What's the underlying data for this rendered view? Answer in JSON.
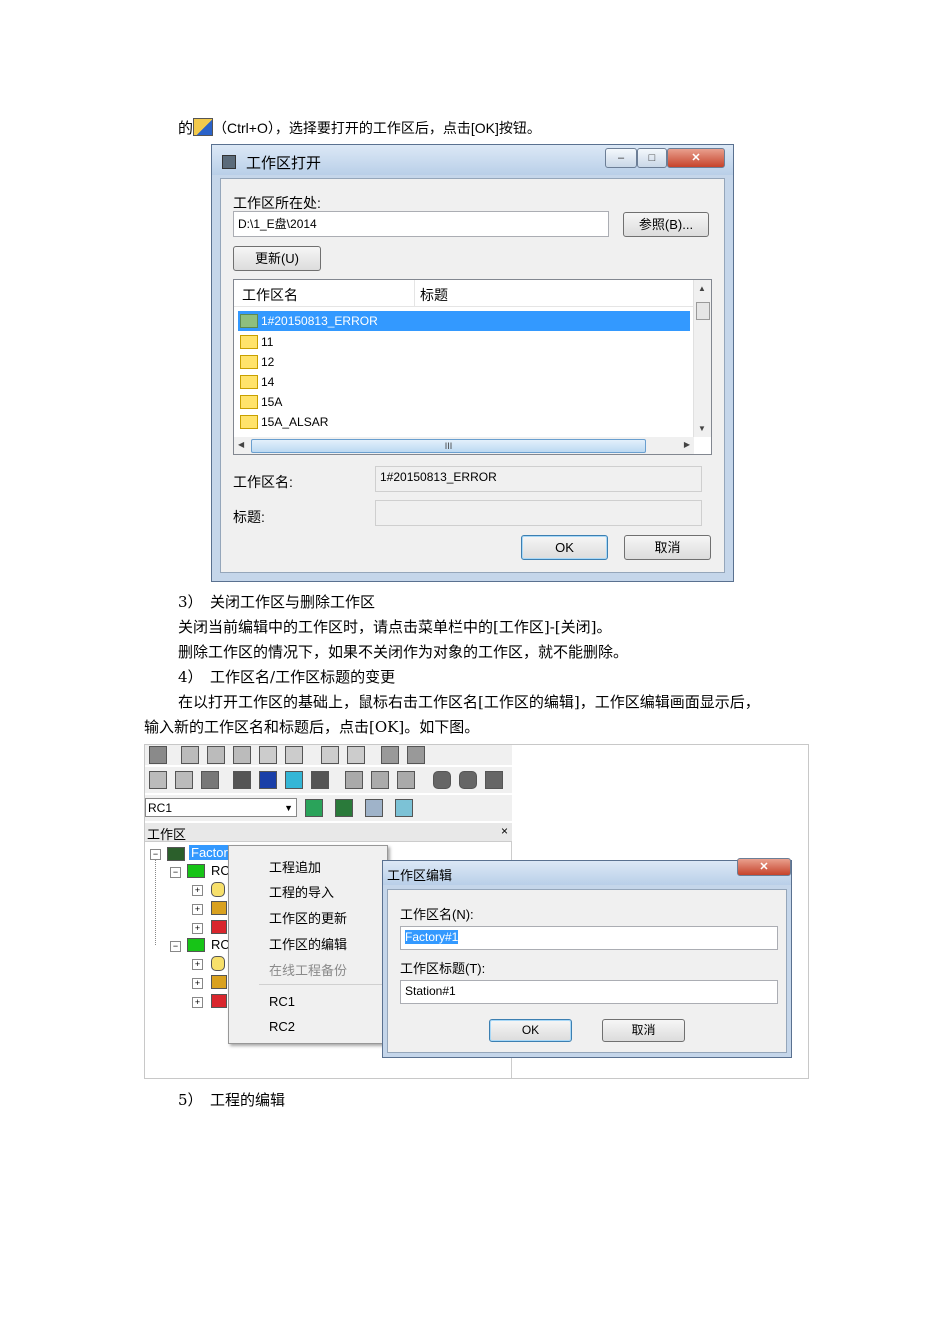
{
  "intro_line": {
    "prefix": "的",
    "suffix": "（Ctrl+O），选择要打开的工作区后，点击[OK]按钮。"
  },
  "dialog_open": {
    "title": "工作区打开",
    "location_label": "工作区所在处:",
    "location_value": "D:\\1_E盘\\2014",
    "browse_button": "参照(B)...",
    "update_button": "更新(U)",
    "columns": [
      "工作区名",
      "标题"
    ],
    "rows": [
      "1#20150813_ERROR",
      "11",
      "12",
      "14",
      "15A",
      "15A_ALSAR"
    ],
    "selected_row": 0,
    "hscroll_thumb": "III",
    "name_label": "工作区名:",
    "name_value": "1#20150813_ERROR",
    "title_label": "标题:",
    "title_value": "",
    "ok_button": "OK",
    "cancel_button": "取消"
  },
  "paragraphs": [
    "3）　关闭工作区与删除工作区",
    "关闭当前编辑中的工作区时，请点击菜单栏中的[工作区]-[关闭]。",
    "删除工作区的情况下，如果不关闭作为对象的工作区，就不能删除。",
    "4）　工作区名/工作区标题的变更",
    "在以打开工作区的基础上，鼠标右击工作区名[工作区的编辑]，工作区编辑画面显示后，",
    "输入新的工作区名和标题后，点击[OK]。如下图。",
    "5）　工程的编辑"
  ],
  "shot2": {
    "combo_value": "RC1",
    "panel_title": "工作区",
    "panel_close": "×",
    "tree_root": "Factory",
    "tree_nodes": [
      "RC",
      "RC"
    ],
    "context_menu": [
      "工程追加",
      "工程的导入",
      "工作区的更新",
      "工作区的编辑",
      "在线工程备份",
      "RC1",
      "RC2"
    ],
    "disabled_item": "在线工程备份",
    "edit_dialog": {
      "title": "工作区编辑",
      "name_label": "工作区名(N):",
      "name_value": "Factory#1",
      "title_label": "工作区标题(T):",
      "title_value": "Station#1",
      "ok_button": "OK",
      "cancel_button": "取消"
    }
  },
  "colors": {
    "selection": "#3399ff",
    "dialog_frame": "#c5d6ea",
    "close_button": "#c6432b"
  }
}
